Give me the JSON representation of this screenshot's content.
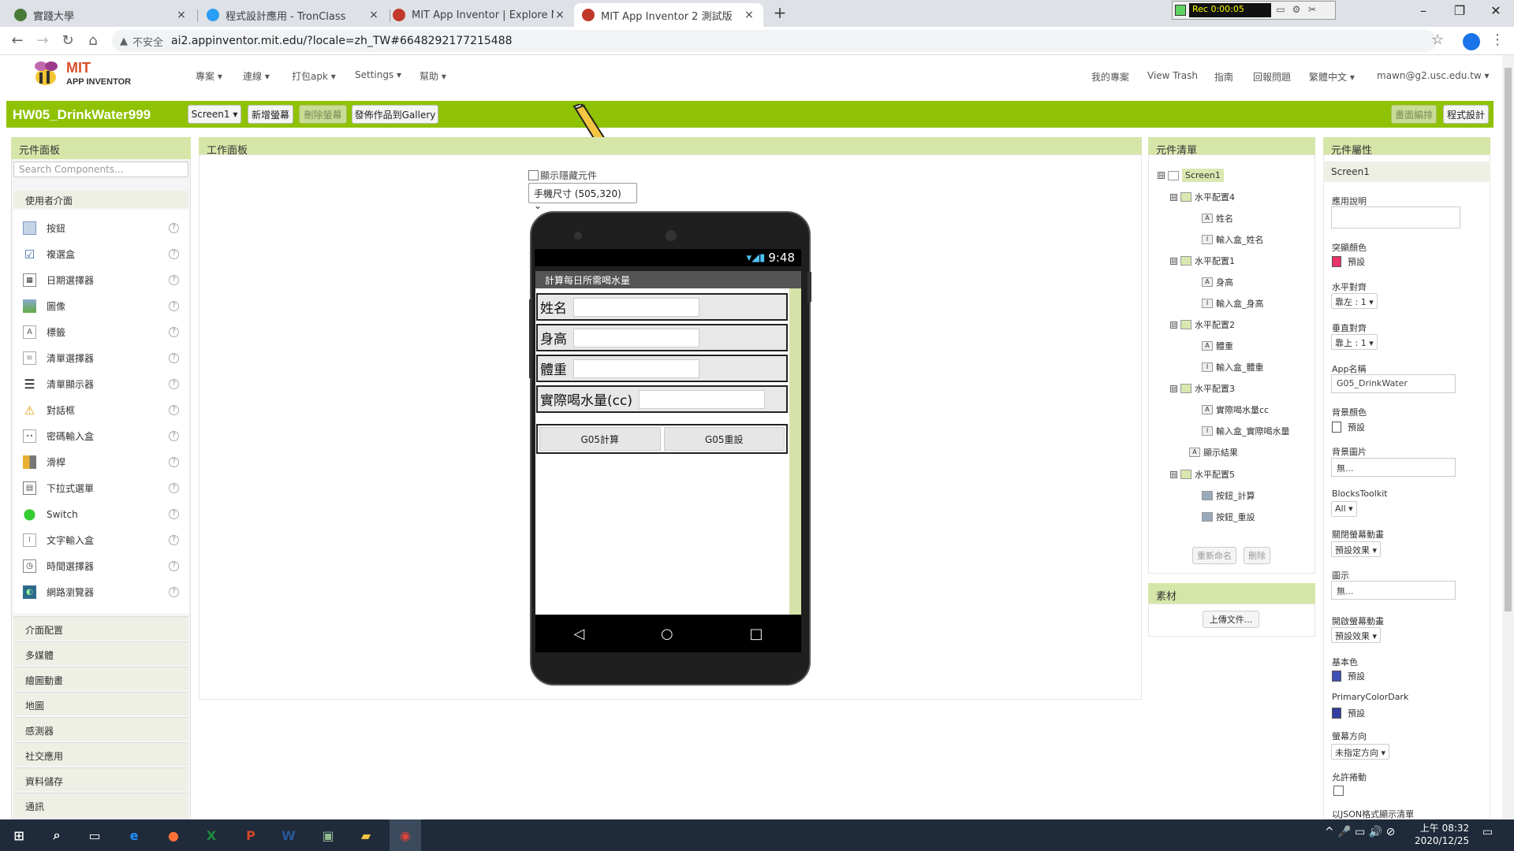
{
  "browser": {
    "tabs": [
      {
        "title": "實踐大學",
        "fav_color": "#4a7a3a"
      },
      {
        "title": "程式設計應用 - TronClass",
        "fav_color": "#2a9df4"
      },
      {
        "title": "MIT App Inventor | Explore MIT",
        "fav_color": "#c0392b"
      },
      {
        "title": "MIT App Inventor 2 測試版",
        "fav_color": "#c0392b"
      }
    ],
    "close_glyph": "×",
    "new_tab": "+",
    "recorder_time": "Rec 0:00:05",
    "win_min": "–",
    "win_max": "❐",
    "win_close": "✕",
    "insecure_label": "不安全",
    "url": "ai2.appinventor.mit.edu/?locale=zh_TW#6648292177215488"
  },
  "header": {
    "logo_mit": "MIT",
    "logo_sub": "APP INVENTOR",
    "menus": [
      "專案 ▾",
      "連線 ▾",
      "打包apk ▾",
      "Settings ▾",
      "幫助 ▾"
    ],
    "right_menus": [
      "我的專案",
      "View Trash",
      "指南",
      "回報問題",
      "繁體中文 ▾",
      "mawn@g2.usc.edu.tw ▾"
    ]
  },
  "toolbar": {
    "project_name": "HW05_DrinkWater999",
    "screen_select": "Screen1 ▾",
    "add_screen": "新增螢幕",
    "remove_screen": "刪除螢幕",
    "publish": "發佈作品到Gallery",
    "designer": "畫面編排",
    "blocks": "程式設計"
  },
  "palette": {
    "title": "元件面板",
    "search_placeholder": "Search Components...",
    "open_category": "使用者介面",
    "items": [
      {
        "label": "按鈕",
        "icon": "button-icon"
      },
      {
        "label": "複選盒",
        "icon": "checkbox-icon"
      },
      {
        "label": "日期選擇器",
        "icon": "date-picker-icon"
      },
      {
        "label": "圖像",
        "icon": "image-icon"
      },
      {
        "label": "標籤",
        "icon": "label-icon"
      },
      {
        "label": "清單選擇器",
        "icon": "list-picker-icon"
      },
      {
        "label": "清單顯示器",
        "icon": "list-view-icon"
      },
      {
        "label": "對話框",
        "icon": "notifier-icon"
      },
      {
        "label": "密碼輸入盒",
        "icon": "password-icon"
      },
      {
        "label": "滑桿",
        "icon": "slider-icon"
      },
      {
        "label": "下拉式選單",
        "icon": "spinner-icon"
      },
      {
        "label": "Switch",
        "icon": "switch-icon"
      },
      {
        "label": "文字輸入盒",
        "icon": "textbox-icon"
      },
      {
        "label": "時間選擇器",
        "icon": "time-picker-icon"
      },
      {
        "label": "網路瀏覽器",
        "icon": "webviewer-icon"
      }
    ],
    "help_glyph": "?",
    "categories": [
      "介面配置",
      "多媒體",
      "繪圖動畫",
      "地圖",
      "感測器",
      "社交應用",
      "資料儲存",
      "通訊"
    ]
  },
  "viewer": {
    "title": "工作面板",
    "show_hidden": "顯示隱藏元件",
    "size_select": "手機尺寸 (505,320) ⌄",
    "status_time": "9:48",
    "status_icons": "▾◢▮",
    "app_title": "計算每日所需喝水量",
    "rows": [
      "姓名",
      "身高",
      "體重",
      "實際喝水量(cc)"
    ],
    "buttons": [
      "G05計算",
      "G05重設"
    ],
    "nav": [
      "◁",
      "○",
      "□"
    ]
  },
  "tree": {
    "title": "元件清單",
    "nodes": [
      {
        "label": "Screen1",
        "toggle": "⊟",
        "icon": "",
        "kind": "screen"
      },
      {
        "label": "水平配置4",
        "toggle": "⊟",
        "icon": "",
        "kind": "arr"
      },
      {
        "label": "姓名",
        "toggle": "",
        "icon": "A",
        "kind": "lab"
      },
      {
        "label": "輸入盒_姓名",
        "toggle": "",
        "icon": "I",
        "kind": "lab"
      },
      {
        "label": "水平配置1",
        "toggle": "⊟",
        "icon": "",
        "kind": "arr"
      },
      {
        "label": "身高",
        "toggle": "",
        "icon": "A",
        "kind": "lab"
      },
      {
        "label": "輸入盒_身高",
        "toggle": "",
        "icon": "I",
        "kind": "lab"
      },
      {
        "label": "水平配置2",
        "toggle": "⊟",
        "icon": "",
        "kind": "arr"
      },
      {
        "label": "體重",
        "toggle": "",
        "icon": "A",
        "kind": "lab"
      },
      {
        "label": "輸入盒_體重",
        "toggle": "",
        "icon": "I",
        "kind": "lab"
      },
      {
        "label": "水平配置3",
        "toggle": "⊟",
        "icon": "",
        "kind": "arr"
      },
      {
        "label": "實際喝水量cc",
        "toggle": "",
        "icon": "A",
        "kind": "lab"
      },
      {
        "label": "輸入盒_實際喝水量",
        "toggle": "",
        "icon": "I",
        "kind": "lab"
      },
      {
        "label": "顯示結果",
        "toggle": "",
        "icon": "A",
        "kind": "lab"
      },
      {
        "label": "水平配置5",
        "toggle": "⊟",
        "icon": "",
        "kind": "arr"
      },
      {
        "label": "按鈕_計算",
        "toggle": "",
        "icon": "",
        "kind": "btn"
      },
      {
        "label": "按鈕_重設",
        "toggle": "",
        "icon": "",
        "kind": "btn"
      }
    ],
    "rename": "重新命名",
    "delete": "刪除",
    "media_title": "素材",
    "upload": "上傳文件..."
  },
  "properties": {
    "title": "元件屬性",
    "component": "Screen1",
    "about_label": "應用說明",
    "accent_label": "突顯顏色",
    "accent_value": "預設",
    "accent_color": "#e8326a",
    "align_h_label": "水平對齊",
    "align_h_value": "靠左 : 1 ▾",
    "align_v_label": "垂直對齊",
    "align_v_value": "靠上 : 1 ▾",
    "appname_label": "App名稱",
    "appname_value": "G05_DrinkWater",
    "bgcolor_label": "背景顏色",
    "bgcolor_value": "預設",
    "bgimage_label": "背景圖片",
    "bgimage_value": "無...",
    "blocks_toolkit_label": "BlocksToolkit",
    "blocks_toolkit_value": "All ▾",
    "close_anim_label": "關閉螢幕動畫",
    "close_anim_value": "預設效果 ▾",
    "icon_label": "圖示",
    "icon_value": "無...",
    "open_anim_label": "開啟螢幕動畫",
    "open_anim_value": "預設效果 ▾",
    "primary_label": "基本色",
    "primary_value": "預設",
    "primary_color": "#3f51b5",
    "primary_dark_label": "PrimaryColorDark",
    "primary_dark_value": "預設",
    "primary_dark_color": "#303f9f",
    "orientation_label": "螢幕方向",
    "orientation_value": "未指定方向 ▾",
    "scrollable_label": "允許捲動",
    "json_label": "以JSON格式顯示清單"
  },
  "taskbar": {
    "start_glyph": "⊞",
    "search_glyph": "⌕",
    "taskview_glyph": "▭",
    "time": "上午 08:32",
    "date": "2020/12/25",
    "tray_icons": "^ 🎤 ▭ 🔊 ⊘",
    "apps": [
      {
        "glyph": "e",
        "color": "#1e90ff"
      },
      {
        "glyph": "●",
        "color": "#ff7139"
      },
      {
        "glyph": "X",
        "color": "#1e8e3e"
      },
      {
        "glyph": "P",
        "color": "#d24726"
      },
      {
        "glyph": "W",
        "color": "#2b579a"
      },
      {
        "glyph": "▣",
        "color": "#8fbc8f"
      },
      {
        "glyph": "▰",
        "color": "#f4c542"
      },
      {
        "glyph": "◉",
        "color": "#db4437"
      }
    ]
  }
}
